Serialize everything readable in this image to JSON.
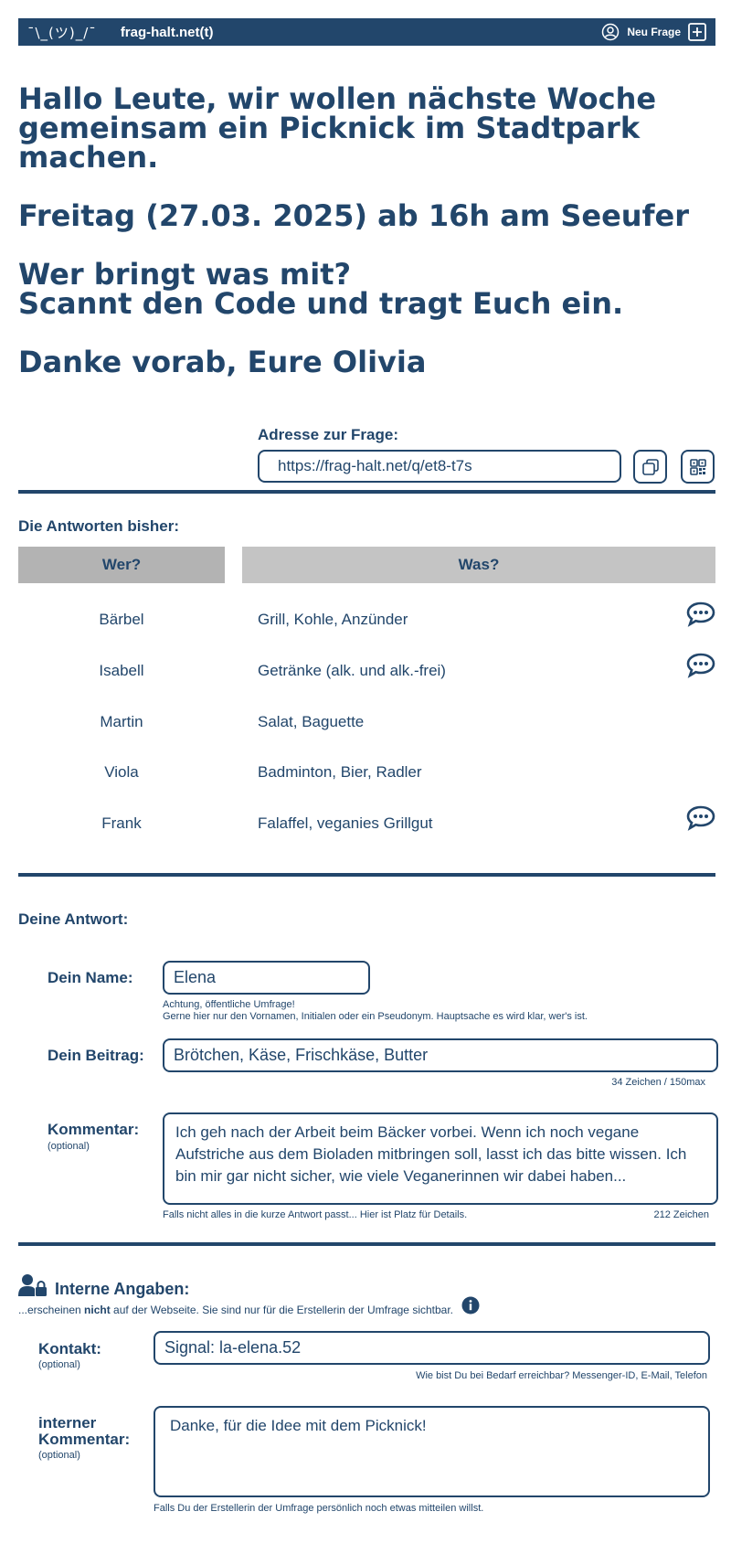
{
  "header": {
    "logo": "¯\\_(ツ)_/¯",
    "site_name": "frag-halt.net(t)",
    "new_question_label": "Neu Frage",
    "icons": [
      "user-circle-icon",
      "plus-square-icon"
    ]
  },
  "intro": {
    "line1": "Hallo Leute, wir wollen nächste Woche",
    "line2": "gemeinsam ein Picknick im Stadtpark",
    "line3": "machen.",
    "line4": "Freitag (27.03. 2025) ab 16h am Seeufer",
    "line5": "Wer bringt was mit?",
    "line6": "Scannt den Code und tragt Euch ein.",
    "line7": "Danke vorab, Eure Olivia"
  },
  "address": {
    "label": "Adresse zur Frage:",
    "url": "https://frag-halt.net/q/et8-t7s",
    "icons": [
      "copy-icon",
      "qr-code-icon"
    ]
  },
  "answers": {
    "title": "Die Antworten bisher:",
    "col_who": "Wer?",
    "col_what": "Was?",
    "rows": [
      {
        "who": "Bärbel",
        "what": "Grill, Kohle, Anzünder",
        "has_comment": true
      },
      {
        "who": "Isabell",
        "what": "Getränke (alk. und alk.-frei)",
        "has_comment": true
      },
      {
        "who": "Martin",
        "what": "Salat, Baguette",
        "has_comment": false
      },
      {
        "who": "Viola",
        "what": "Badminton, Bier, Radler",
        "has_comment": false
      },
      {
        "who": "Frank",
        "what": "Falaffel, veganies Grillgut",
        "has_comment": true
      }
    ]
  },
  "form": {
    "title": "Deine Antwort:",
    "name_label": "Dein Name:",
    "name_value": "Elena",
    "name_hint1": "Achtung, öffentliche Umfrage!",
    "name_hint2": "Gerne hier nur den Vornamen, Initialen oder ein Pseudonym. Hauptsache es wird klar, wer's ist.",
    "contribution_label": "Dein Beitrag:",
    "contribution_value": "Brötchen, Käse, Frischkäse, Butter",
    "contribution_count": "34 Zeichen / 150max",
    "comment_label": "Kommentar:",
    "comment_optional": "(optional)",
    "comment_value": "Ich geh nach der Arbeit beim Bäcker vorbei. Wenn ich noch vegane Aufstriche aus dem Bioladen mitbringen soll, lasst ich das bitte wissen. Ich bin mir gar nicht sicher, wie viele Veganerinnen wir dabei haben...",
    "comment_hint": "Falls nicht alles in die kurze Antwort passt... Hier ist Platz für Details.",
    "comment_count": "212 Zeichen"
  },
  "internal": {
    "title": "Interne Angaben:",
    "note_prefix": "...erscheinen ",
    "note_bold": "nicht",
    "note_suffix": " auf der Webseite. Sie sind nur für die Erstellerin der Umfrage sichtbar.",
    "contact_label": "Kontakt:",
    "contact_optional": "(optional)",
    "contact_value": "Signal: la-elena.52",
    "contact_hint": "Wie bist Du bei Bedarf erreichbar? Messenger-ID, E-Mail, Telefon",
    "internal_comment_label1": "interner",
    "internal_comment_label2": "Kommentar:",
    "internal_comment_optional": "(optional)",
    "internal_comment_value": "Danke, für die Idee mit dem Picknick!",
    "internal_comment_hint": "Falls Du der Erstellerin der Umfrage persönlich noch etwas mitteilen willst."
  },
  "colors": {
    "primary": "#22466b",
    "header_who_bg": "#b3b3b3",
    "header_what_bg": "#c4c4c4"
  }
}
